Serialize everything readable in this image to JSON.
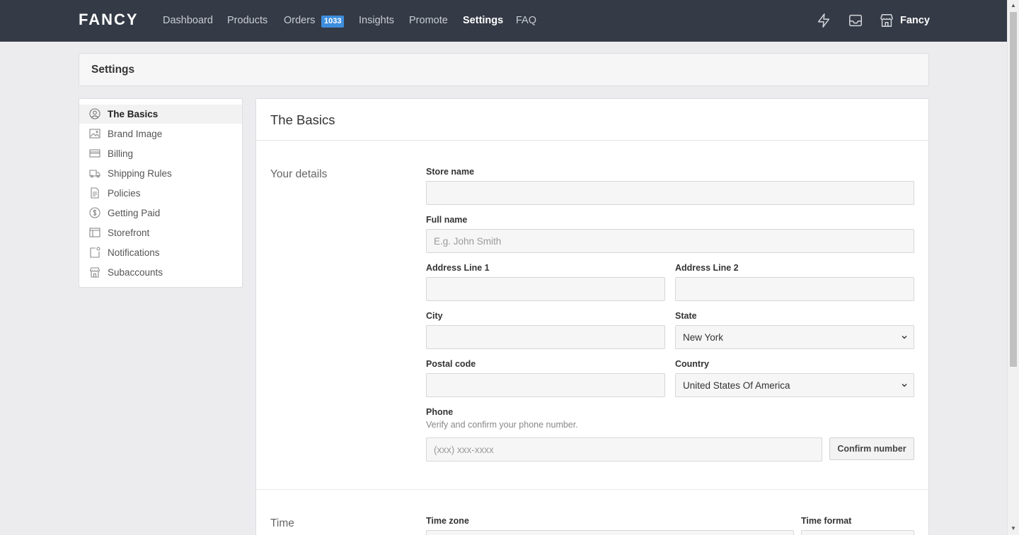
{
  "brand": {
    "logo": "FANCY",
    "account_name": "Fancy"
  },
  "nav": {
    "items": [
      {
        "label": "Dashboard",
        "active": false
      },
      {
        "label": "Products",
        "active": false
      },
      {
        "label": "Orders",
        "active": false
      },
      {
        "label": "Insights",
        "active": false
      },
      {
        "label": "Promote",
        "active": false
      },
      {
        "label": "Settings",
        "active": true
      },
      {
        "label": "FAQ",
        "active": false
      }
    ],
    "orders_badge": "1033",
    "icons": [
      "lightning-icon",
      "inbox-icon",
      "store-icon"
    ]
  },
  "page": {
    "title": "Settings"
  },
  "sidebar": {
    "items": [
      {
        "label": "The Basics",
        "icon": "user-circle-icon",
        "active": true
      },
      {
        "label": "Brand Image",
        "icon": "image-icon",
        "active": false
      },
      {
        "label": "Billing",
        "icon": "credit-card-icon",
        "active": false
      },
      {
        "label": "Shipping Rules",
        "icon": "truck-icon",
        "active": false
      },
      {
        "label": "Policies",
        "icon": "document-icon",
        "active": false
      },
      {
        "label": "Getting Paid",
        "icon": "dollar-coin-icon",
        "active": false
      },
      {
        "label": "Storefront",
        "icon": "layout-icon",
        "active": false
      },
      {
        "label": "Notifications",
        "icon": "notification-icon",
        "active": false
      },
      {
        "label": "Subaccounts",
        "icon": "store-icon",
        "active": false
      }
    ]
  },
  "main": {
    "title": "The Basics",
    "details": {
      "section_title": "Your details",
      "store_name": {
        "label": "Store name",
        "value": "",
        "placeholder": ""
      },
      "full_name": {
        "label": "Full name",
        "value": "",
        "placeholder": "E.g. John Smith"
      },
      "address1": {
        "label": "Address Line 1",
        "value": ""
      },
      "address2": {
        "label": "Address Line 2",
        "value": ""
      },
      "city": {
        "label": "City",
        "value": ""
      },
      "state": {
        "label": "State",
        "value": "New York"
      },
      "postal": {
        "label": "Postal code",
        "value": ""
      },
      "country": {
        "label": "Country",
        "value": "United States Of America"
      },
      "phone": {
        "label": "Phone",
        "help": "Verify and confirm your phone number.",
        "placeholder": "(xxx) xxx-xxxx",
        "confirm_label": "Confirm number"
      }
    },
    "time": {
      "section_title": "Time",
      "timezone_label": "Time zone",
      "format_label": "Time format"
    }
  }
}
